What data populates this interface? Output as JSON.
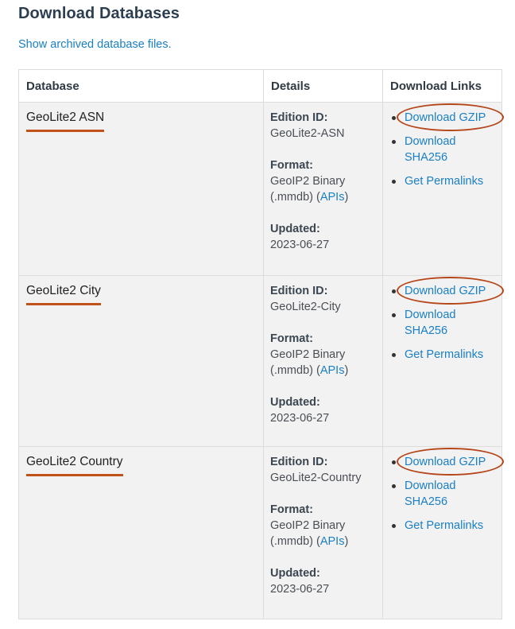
{
  "page": {
    "title": "Download Databases",
    "archived_link": "Show archived database files."
  },
  "table": {
    "headers": [
      "Database",
      "Details",
      "Download Links"
    ],
    "details_labels": {
      "edition": "Edition ID:",
      "format": "Format:",
      "updated": "Updated:"
    },
    "link_labels": {
      "gzip": "Download GZIP",
      "sha_line1": "Download",
      "sha_line2": "SHA256",
      "permalinks": "Get Permalinks"
    },
    "rows": [
      {
        "name": "GeoLite2 ASN",
        "edition_id": "GeoLite2-ASN",
        "format_line1": "GeoIP2 Binary",
        "format_pre": "(.mmdb) (",
        "format_link": "APIs",
        "format_post": ")",
        "updated": "2023-06-27"
      },
      {
        "name": "GeoLite2 City",
        "edition_id": "GeoLite2-City",
        "format_line1": "GeoIP2 Binary",
        "format_pre": "(.mmdb) (",
        "format_link": "APIs",
        "format_post": ")",
        "updated": "2023-06-27"
      },
      {
        "name": "GeoLite2 Country",
        "edition_id": "GeoLite2-Country",
        "format_line1": "GeoIP2 Binary",
        "format_pre": "(.mmdb) (",
        "format_link": "APIs",
        "format_post": ")",
        "updated": "2023-06-27"
      }
    ]
  },
  "colors": {
    "link": "#1a7fc4",
    "annotation": "#c0521a",
    "row_background": "#f2f2f2",
    "heading": "#2c3e50"
  }
}
